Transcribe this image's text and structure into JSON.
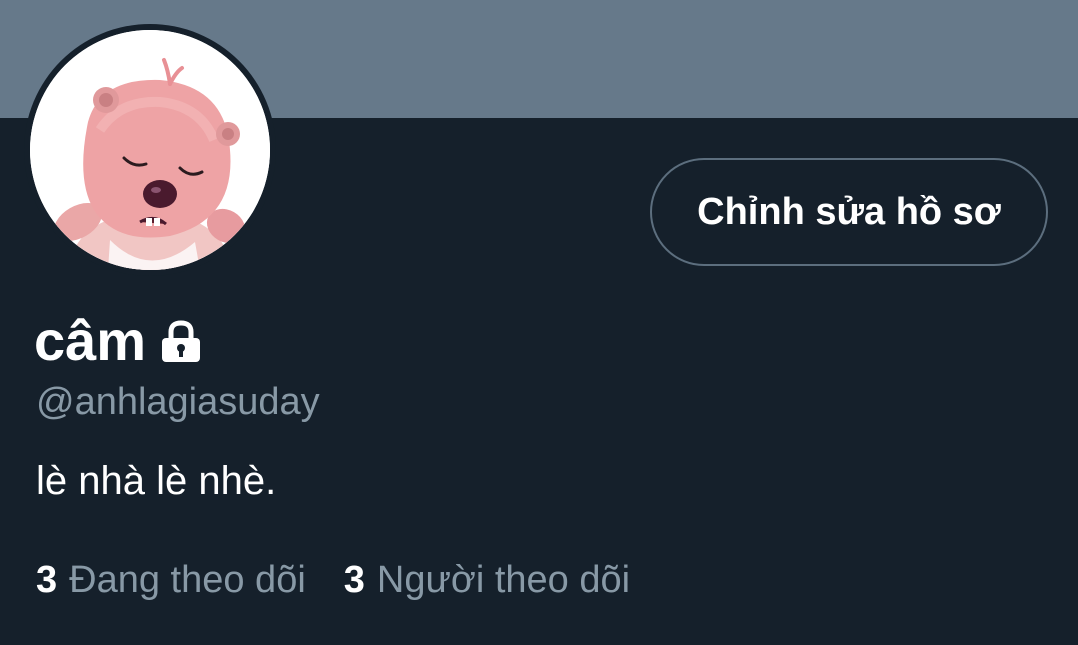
{
  "profile": {
    "display_name": "câm",
    "handle": "@anhlagiasuday",
    "bio": "lè nhà lè nhè.",
    "protected_icon": "lock-icon",
    "avatar_icon": "pink-beaver-avatar"
  },
  "actions": {
    "edit_profile_label": "Chỉnh sửa hồ sơ"
  },
  "stats": {
    "following_count": "3",
    "following_label": "Đang theo dõi",
    "followers_count": "3",
    "followers_label": "Người theo dõi"
  },
  "colors": {
    "background": "#15202b",
    "banner": "#66798a",
    "secondary_text": "#8899a6",
    "border": "#5c6e7e"
  }
}
